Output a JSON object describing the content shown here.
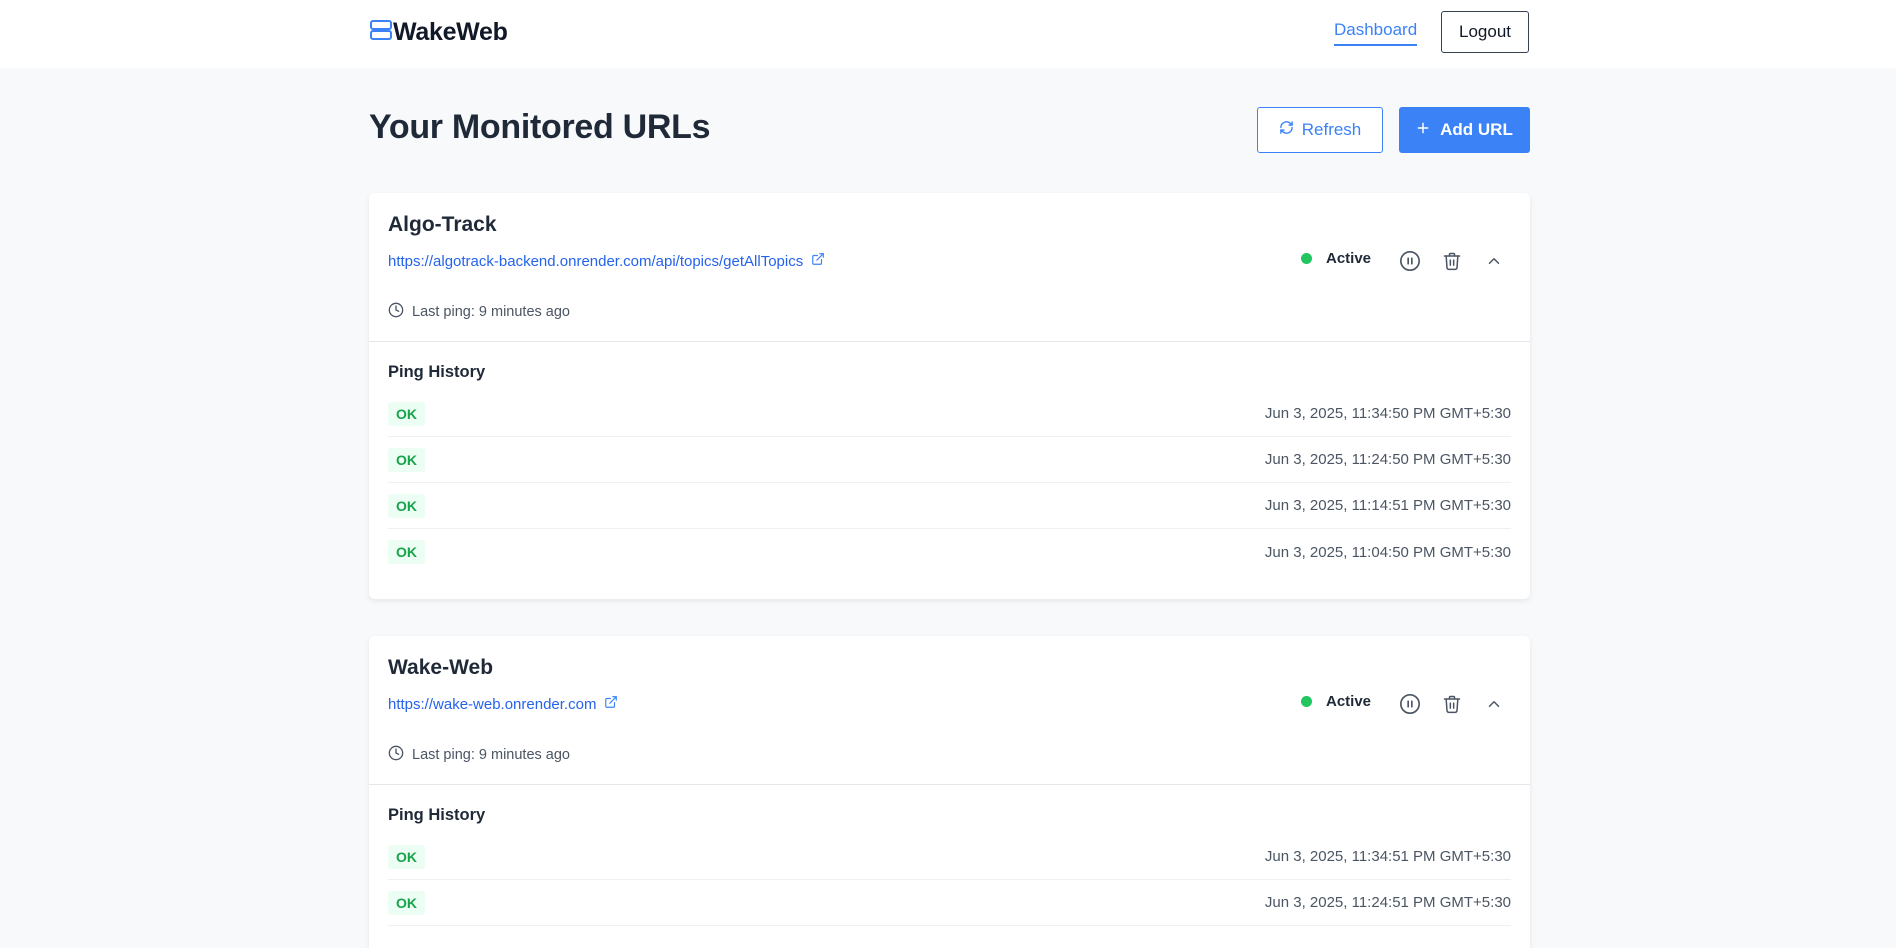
{
  "nav": {
    "brand": "WakeWeb",
    "dashboard_link": "Dashboard",
    "logout": "Logout"
  },
  "main": {
    "title": "Your Monitored URLs",
    "refresh_label": "Refresh",
    "add_label": "Add URL"
  },
  "monitors": [
    {
      "name": "Algo-Track",
      "url": "https://algotrack-backend.onrender.com/api/topics/getAllTopics",
      "last_ping": "Last ping: 9 minutes ago",
      "status": "Active",
      "history_title": "Ping History",
      "history": [
        {
          "status": "OK",
          "time": "Jun 3, 2025, 11:34:50 PM GMT+5:30"
        },
        {
          "status": "OK",
          "time": "Jun 3, 2025, 11:24:50 PM GMT+5:30"
        },
        {
          "status": "OK",
          "time": "Jun 3, 2025, 11:14:51 PM GMT+5:30"
        },
        {
          "status": "OK",
          "time": "Jun 3, 2025, 11:04:50 PM GMT+5:30"
        }
      ]
    },
    {
      "name": "Wake-Web",
      "url": "https://wake-web.onrender.com",
      "last_ping": "Last ping: 9 minutes ago",
      "status": "Active",
      "history_title": "Ping History",
      "history": [
        {
          "status": "OK",
          "time": "Jun 3, 2025, 11:34:51 PM GMT+5:30"
        },
        {
          "status": "OK",
          "time": "Jun 3, 2025, 11:24:51 PM GMT+5:30"
        }
      ]
    }
  ],
  "colors": {
    "accent": "#3b82f6",
    "active": "#22c55e",
    "ok_text": "#16a34a",
    "ok_bg": "#ecfdf3"
  }
}
